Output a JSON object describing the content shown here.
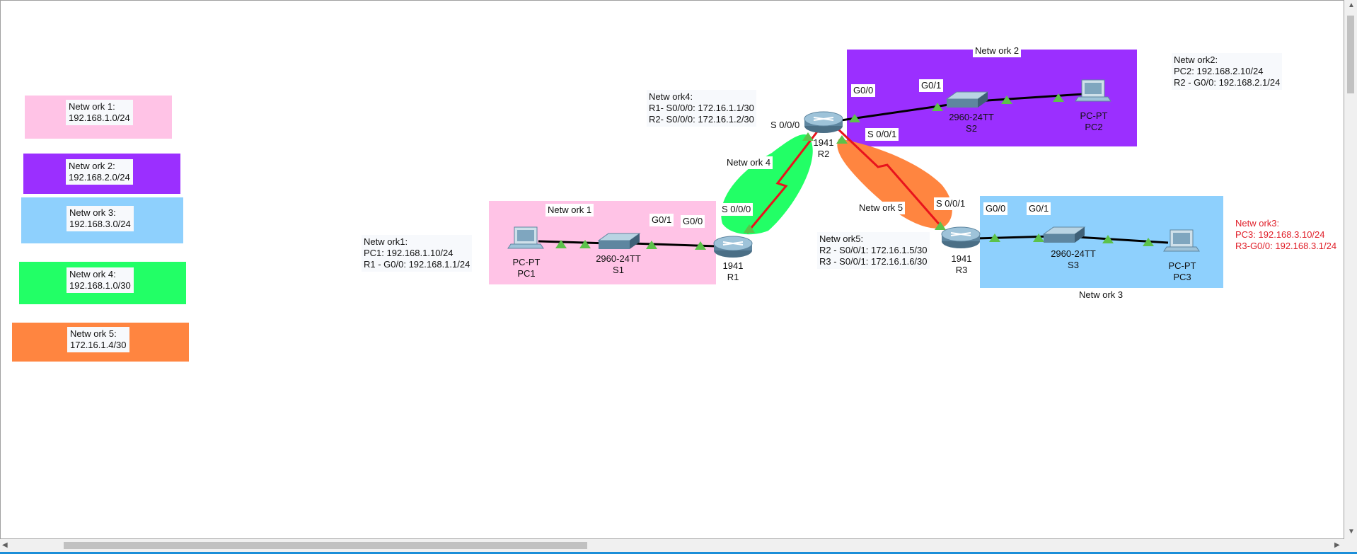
{
  "legend": [
    {
      "line1": "Netw ork 1:",
      "line2": "192.168.1.0/24",
      "color": "#ffc3e6"
    },
    {
      "line1": "Netw ork 2:",
      "line2": "192.168.2.0/24",
      "color": "#9b2fff"
    },
    {
      "line1": "Netw ork 3:",
      "line2": "192.168.3.0/24",
      "color": "#8ed0fd"
    },
    {
      "line1": "Netw ork 4:",
      "line2": "192.168.1.0/30",
      "color": "#22ff66"
    },
    {
      "line1": "Netw ork 5:",
      "line2": "172.16.1.4/30",
      "color": "#ff8540"
    }
  ],
  "regions": {
    "network1": {
      "title": "Netw ork 1",
      "color": "#ffc3e6"
    },
    "network2": {
      "title": "Netw ork 2",
      "color": "#9b2fff"
    },
    "network3": {
      "title": "Netw ork 3",
      "color": "#8ed0fd"
    },
    "network4": {
      "title": "Netw ork 4",
      "color": "#22ff66"
    },
    "network5": {
      "title": "Netw ork 5",
      "color": "#ff8540"
    }
  },
  "notes": {
    "network1": "Netw ork1:\nPC1: 192.168.1.10/24\nR1 - G0/0: 192.168.1.1/24",
    "network4": "Netw ork4:\nR1- S0/0/0: 172.16.1.1/30\nR2- S0/0/0: 172.16.1.2/30",
    "network5": "Netw ork5:\nR2 - S0/0/1: 172.16.1.5/30\nR3 - S0/0/1: 172.16.1.6/30",
    "network2": "Netw ork2:\nPC2: 192.168.2.10/24\nR2 - G0/0: 192.168.2.1/24",
    "network3": "Netw ork3:\nPC3: 192.168.3.10/24\nR3-G0/0: 192.168.3.1/24"
  },
  "interfaces": {
    "s1_g01": "G0/1",
    "r1_g00": "G0/0",
    "r1_s000": "S 0/0/0",
    "r2_s000": "S 0/0/0",
    "r2_g00": "G0/0",
    "s2_g01": "G0/1",
    "r2_s001": "S 0/0/1",
    "r3_s001": "S 0/0/1",
    "r3_g00": "G0/0",
    "s3_g01": "G0/1"
  },
  "devices": {
    "pc1": {
      "model": "PC-PT",
      "name": "PC1"
    },
    "s1": {
      "model": "2960-24TT",
      "name": "S1"
    },
    "r1": {
      "model": "1941",
      "name": "R1"
    },
    "r2": {
      "model": "1941",
      "name": "R2"
    },
    "s2": {
      "model": "2960-24TT",
      "name": "S2"
    },
    "pc2": {
      "model": "PC-PT",
      "name": "PC2"
    },
    "r3": {
      "model": "1941",
      "name": "R3"
    },
    "s3": {
      "model": "2960-24TT",
      "name": "S3"
    },
    "pc3": {
      "model": "PC-PT",
      "name": "PC3"
    }
  },
  "colors": {
    "ethernet_link": "#000000",
    "serial_link": "#e8141c",
    "port_up": "#5cc24a",
    "note_red": "#e0202a"
  },
  "icons": [
    "router-icon",
    "switch-icon",
    "pc-icon",
    "port-up-icon"
  ]
}
